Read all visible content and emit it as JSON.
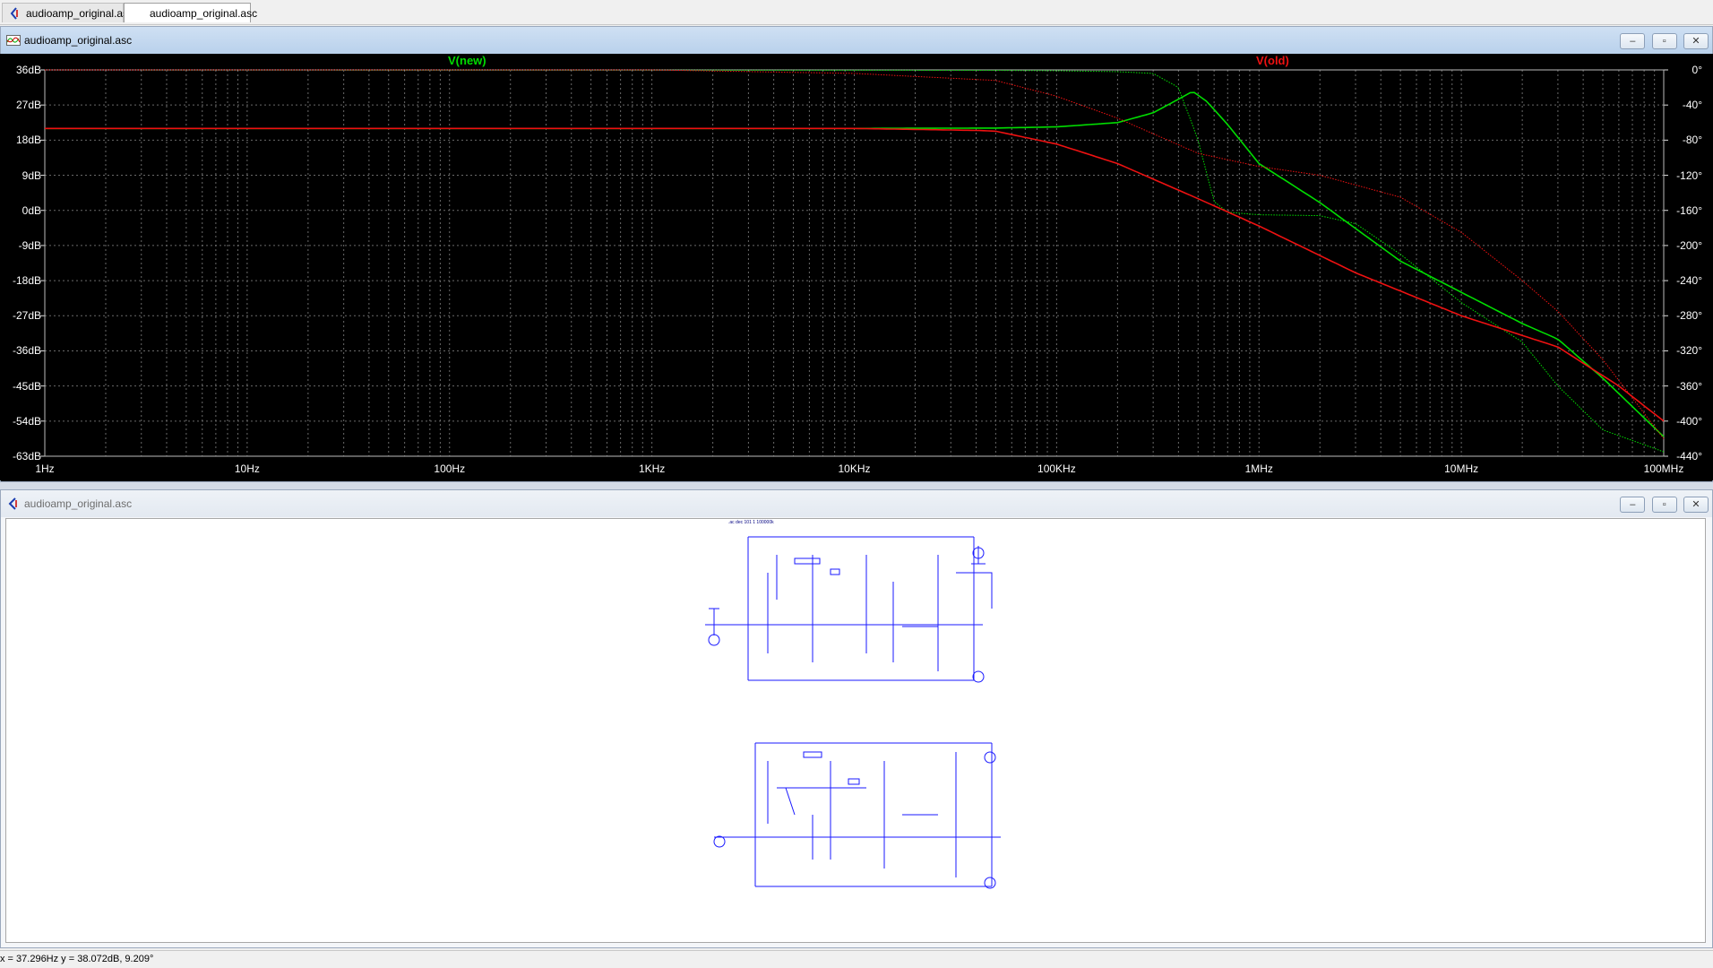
{
  "tabs": [
    {
      "label": "audioamp_original.asc",
      "active": false
    },
    {
      "label": "audioamp_original.asc",
      "active": true
    }
  ],
  "plot_window": {
    "title": "audioamp_original.asc",
    "buttons": {
      "minimize": "–",
      "restore": "▫",
      "close": "✕"
    }
  },
  "schematic_window": {
    "title": "audioamp_original.asc",
    "buttons": {
      "minimize": "–",
      "restore": "▫",
      "close": "✕"
    },
    "top_directive": ".ac dec 101 1 100000k"
  },
  "statusbar": {
    "text": "x = 37.296Hz    y = 38.072dB, 9.209°"
  },
  "chart_data": {
    "type": "line",
    "x_scale": "log",
    "xlim": [
      1,
      100000000
    ],
    "x_ticks": [
      "1Hz",
      "10Hz",
      "100Hz",
      "1KHz",
      "10KHz",
      "100KHz",
      "1MHz",
      "10MHz",
      "100MHz"
    ],
    "y_left_ticks": [
      "36dB",
      "27dB",
      "18dB",
      "9dB",
      "0dB",
      "-9dB",
      "-18dB",
      "-27dB",
      "-36dB",
      "-45dB",
      "-54dB",
      "-63dB"
    ],
    "y_left_range": [
      -63,
      36
    ],
    "y_right_ticks": [
      "0°",
      "-40°",
      "-80°",
      "-120°",
      "-160°",
      "-200°",
      "-240°",
      "-280°",
      "-320°",
      "-360°",
      "-400°",
      "-440°"
    ],
    "y_right_range": [
      -440,
      0
    ],
    "grid": true,
    "colors": {
      "new": "#00dd00",
      "old": "#ee1111",
      "background": "#000000",
      "grid": "#6a6a6a",
      "phase_overlap": "#cccc33"
    },
    "series": [
      {
        "name": "V(new)",
        "color": "#00dd00",
        "magnitude_db": [
          [
            1,
            21
          ],
          [
            10000,
            21
          ],
          [
            50000,
            21.1
          ],
          [
            100000,
            21.4
          ],
          [
            200000,
            22.5
          ],
          [
            300000,
            25
          ],
          [
            400000,
            28.5
          ],
          [
            470000,
            30.5
          ],
          [
            550000,
            28
          ],
          [
            700000,
            22
          ],
          [
            1000000,
            12
          ],
          [
            2000000,
            2
          ],
          [
            5000000,
            -13
          ],
          [
            10000000,
            -21
          ],
          [
            20000000,
            -29
          ],
          [
            30000000,
            -33
          ],
          [
            50000000,
            -43
          ],
          [
            100000000,
            -58
          ]
        ],
        "phase_deg": [
          [
            1,
            0
          ],
          [
            50000,
            -0.5
          ],
          [
            100000,
            -1
          ],
          [
            200000,
            -2
          ],
          [
            300000,
            -4
          ],
          [
            400000,
            -20
          ],
          [
            500000,
            -80
          ],
          [
            600000,
            -150
          ],
          [
            700000,
            -162
          ],
          [
            1000000,
            -165
          ],
          [
            2000000,
            -166
          ],
          [
            3000000,
            -175
          ],
          [
            5000000,
            -210
          ],
          [
            10000000,
            -265
          ],
          [
            20000000,
            -310
          ],
          [
            30000000,
            -360
          ],
          [
            50000000,
            -410
          ],
          [
            100000000,
            -435
          ]
        ]
      },
      {
        "name": "V(old)",
        "color": "#ee1111",
        "magnitude_db": [
          [
            1,
            21
          ],
          [
            10000,
            21
          ],
          [
            40000,
            20.5
          ],
          [
            100000,
            17
          ],
          [
            200000,
            12
          ],
          [
            500000,
            3
          ],
          [
            1000000,
            -4
          ],
          [
            3000000,
            -16
          ],
          [
            10000000,
            -27
          ],
          [
            30000000,
            -35
          ],
          [
            50000,
            20.3
          ],
          [
            60000000,
            -45
          ],
          [
            100000000,
            -54
          ]
        ],
        "phase_deg": [
          [
            1,
            0
          ],
          [
            1000,
            0
          ],
          [
            10000,
            -4
          ],
          [
            50000,
            -12
          ],
          [
            100000,
            -30
          ],
          [
            200000,
            -55
          ],
          [
            500000,
            -95
          ],
          [
            1000000,
            -110
          ],
          [
            2000000,
            -120
          ],
          [
            5000000,
            -145
          ],
          [
            10000000,
            -185
          ],
          [
            20000000,
            -240
          ],
          [
            30000000,
            -275
          ],
          [
            50000000,
            -330
          ],
          [
            100000000,
            -420
          ]
        ]
      }
    ]
  }
}
